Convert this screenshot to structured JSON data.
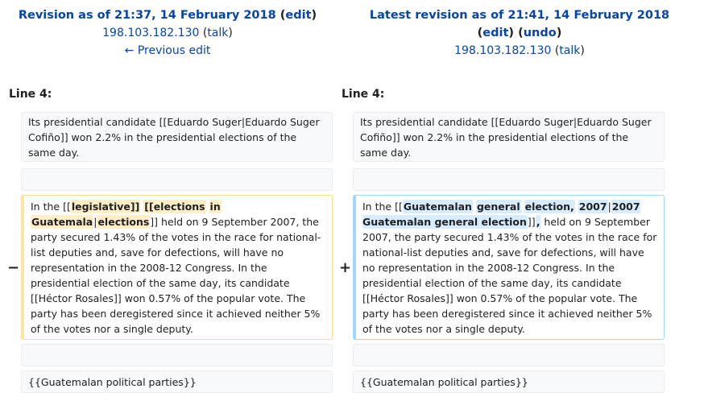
{
  "left_header": {
    "title_prefix": "Revision as of 21:37, 14 February 2018",
    "paren_open": " (",
    "edit_link": "edit",
    "paren_close": ")",
    "user_link": "198.103.182.130",
    "talk_open": " (",
    "talk_link": "talk",
    "talk_close": ")",
    "prev_link": "← Previous edit"
  },
  "right_header": {
    "title": "Latest revision as of 21:41, 14 February 2018",
    "edit_open": "(",
    "edit_link": "edit",
    "edit_mid": ") (",
    "undo_link": "undo",
    "edit_close": ")",
    "user_link": "198.103.182.130",
    "talk_open": " (",
    "talk_link": "talk",
    "talk_close": ")"
  },
  "line_label_left": "Line 4:",
  "line_label_right": "Line 4:",
  "context_top": "Its presidential candidate [[Eduardo Suger|Eduardo Suger Cofiño]] won 2.2% in the presidential elections of the same day.",
  "minus_marker": "−",
  "plus_marker": "+",
  "deleted": {
    "t1": "In the [[",
    "d1": "legislative]]",
    "t2": " ",
    "d2": "[[elections",
    "t3": " ",
    "d3": "in",
    "t4": " ",
    "d4": "Guatemala",
    "t5": "|",
    "d5": "elections",
    "t6": "]] held on 9 September 2007, the party secured 1.43% of the votes in the race for national-list deputies and, save for defections, will have no representation in the 2008-12 Congress.  In the presidential election of the same day, its candidate [[Héctor Rosales]] won 0.57% of the popular vote. The party has been deregistered since it achieved neither 5% of the votes nor a single deputy."
  },
  "added": {
    "t1": "In the [[",
    "i1": "Guatemalan",
    "t2": " ",
    "i2": "general",
    "t3": " ",
    "i3": "election,",
    "t4": " ",
    "i4": "2007",
    "t5": "|",
    "i5": "2007 Guatemalan general election",
    "t6": "]]",
    "i6": ",",
    "t7": " held on 9 September 2007, the party secured 1.43% of the votes in the race for national-list deputies and, save for defections, will have no representation in the 2008-12 Congress.  In the presidential election of the same day, its candidate [[Héctor Rosales]] won 0.57% of the popular vote. The party has been deregistered since it achieved neither 5% of the votes nor a single deputy."
  },
  "context_bottom": "{{Guatemalan political parties}}"
}
